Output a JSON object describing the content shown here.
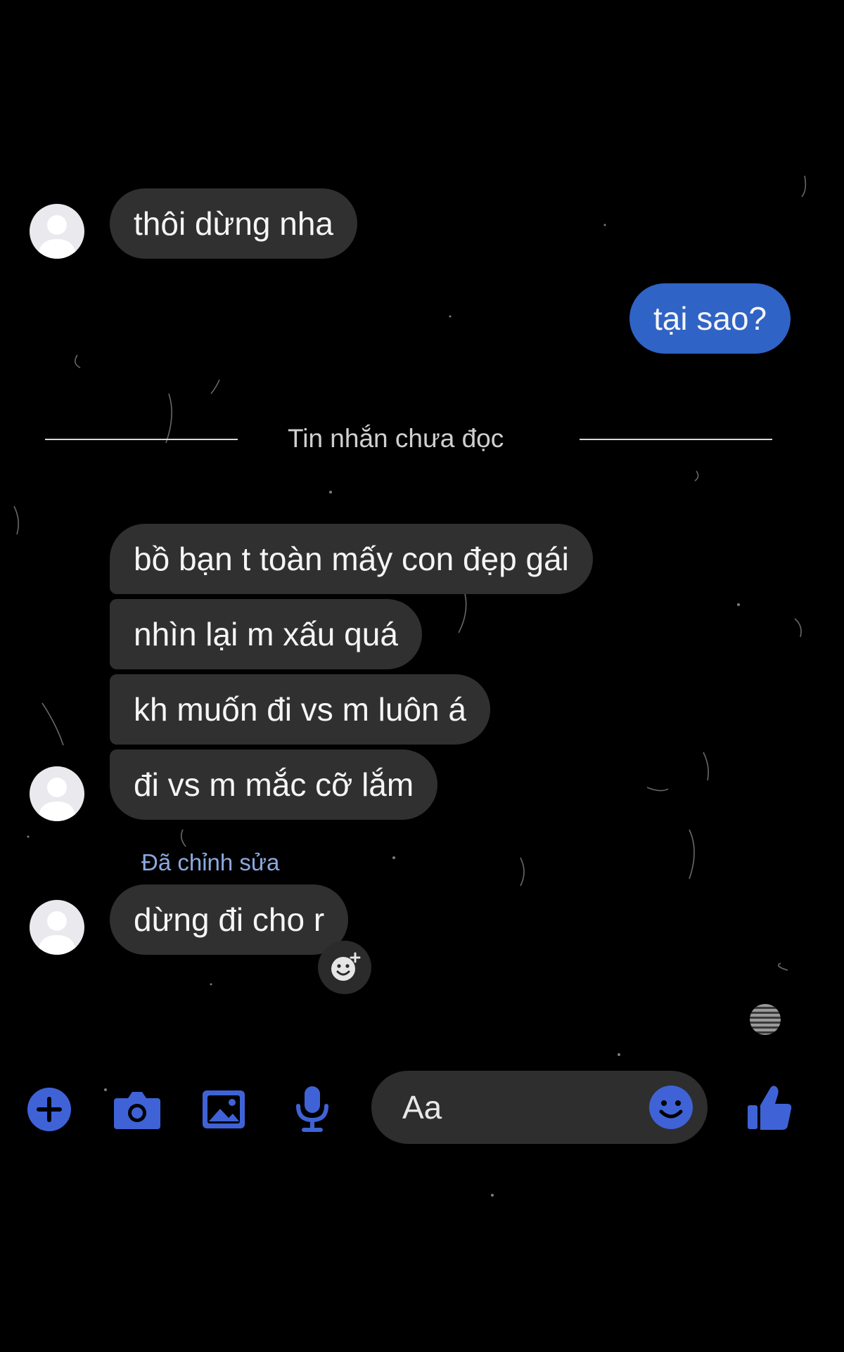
{
  "colors": {
    "background": "#000000",
    "incoming_bubble": "#303030",
    "outgoing_bubble": "#2f63c6",
    "accent_blue": "#3f63d6",
    "edited_label": "#8aa9e0"
  },
  "messages": [
    {
      "sender": "them",
      "text": "thôi dừng nha"
    },
    {
      "sender": "me",
      "text": "tại sao?"
    }
  ],
  "divider": {
    "label": "Tin nhắn chưa đọc"
  },
  "unread_messages": [
    {
      "sender": "them",
      "text": "bồ bạn t toàn mấy con đẹp gái"
    },
    {
      "sender": "them",
      "text": "nhìn lại m xấu quá"
    },
    {
      "sender": "them",
      "text": "kh muốn đi vs m luôn á"
    },
    {
      "sender": "them",
      "text": "đi vs m mắc cỡ lắm"
    }
  ],
  "edited_label": "Đã chỉnh sửa",
  "last_message": {
    "sender": "them",
    "text": "dừng đi cho r"
  },
  "composer": {
    "placeholder": "Aa",
    "icons": [
      "plus-icon",
      "camera-icon",
      "image-icon",
      "microphone-icon",
      "emoji-icon",
      "thumbs-up-icon"
    ]
  }
}
